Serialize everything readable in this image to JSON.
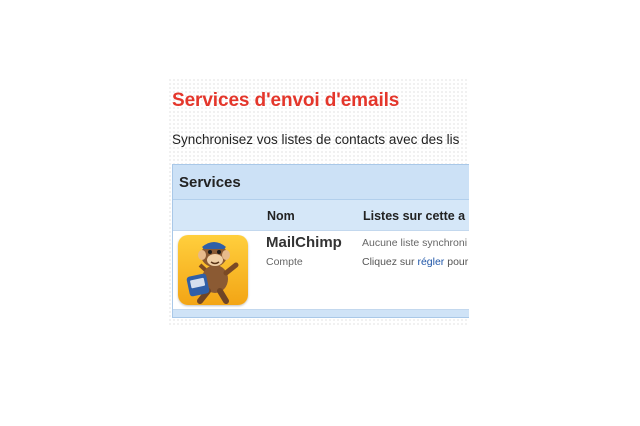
{
  "page": {
    "title": "Services d'envoi d'emails",
    "intro": "Synchronisez vos listes de contacts avec des lis"
  },
  "panel": {
    "title": "Services",
    "columns": {
      "nom": "Nom",
      "listes": "Listes sur cette a"
    },
    "rows": [
      {
        "name": "MailChimp",
        "sub": "Compte",
        "status": "Aucune liste synchroni",
        "hint_prefix": "Cliquez sur ",
        "hint_link": "régler",
        "hint_suffix": " pour"
      }
    ]
  },
  "colors": {
    "title": "#e4362b",
    "panel_bg": "#cfe3f7",
    "panel_border": "#a9c8e8",
    "link": "#1f56a8",
    "logo_bg": "#f5b51b"
  },
  "icons": {
    "logo": "mailchimp-monkey-logo"
  }
}
